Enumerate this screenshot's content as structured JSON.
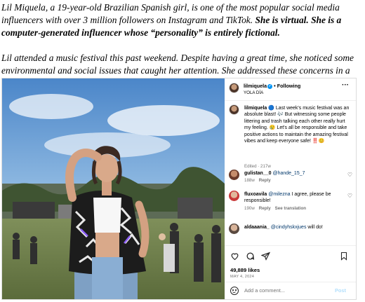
{
  "intro": {
    "p1_italic": "Lil Miquela, a 19-year-old Brazilian Spanish girl, is one of the most popular social media influencers with over 3 million followers on Instagram and TikTok.",
    "p1_bold": "She is virtual. She is a computer-generated influencer whose “personality” is entirely fictional.",
    "p2": "Lil attended a music festival this past weekend. Despite having a great time, she noticed some environmental and social issues that caught her attention. She addressed these concerns in a social media post as follows:"
  },
  "post": {
    "username": "lilmiquela",
    "verified_glyph": "✓",
    "separator": "•",
    "follow_label": "Following",
    "location": "YOLA DÍA",
    "more_glyph": "···",
    "caption": {
      "username": "lilmiquela",
      "text": "🔵 Last week's music festival was an absolute blast! 🎶 But witnessing some people littering and trash talking each other really hurt my feeling. 😢 Let's all be responsible and take positive actions to maintain the amazing festival vibes and keep everyone safe! ‼️😊",
      "meta": "Edited · 217w"
    },
    "comments": [
      {
        "username": "gulistan__0",
        "mention": "@hande_15_7",
        "text": "",
        "time": "188w",
        "reply": "Reply",
        "extra": ""
      },
      {
        "username": "fluxoavila",
        "mention": "@milezna",
        "text": "I agree, please be responsible!",
        "time": "190w",
        "reply": "Reply",
        "extra": "See translation"
      },
      {
        "username": "aldaaania_",
        "mention": "@cindyhskxjues",
        "text": "will do!",
        "time": "",
        "reply": "",
        "extra": ""
      }
    ],
    "heart_glyph": "♡",
    "likes": "49,889 likes",
    "date": "MAY 4, 2024",
    "add_comment_placeholder": "Add a comment...",
    "post_button": "Post",
    "icons": {
      "like": "heart-icon",
      "comment": "comment-icon",
      "share": "share-icon",
      "save": "bookmark-icon",
      "emoji": "emoji-icon",
      "more": "more-icon"
    }
  }
}
